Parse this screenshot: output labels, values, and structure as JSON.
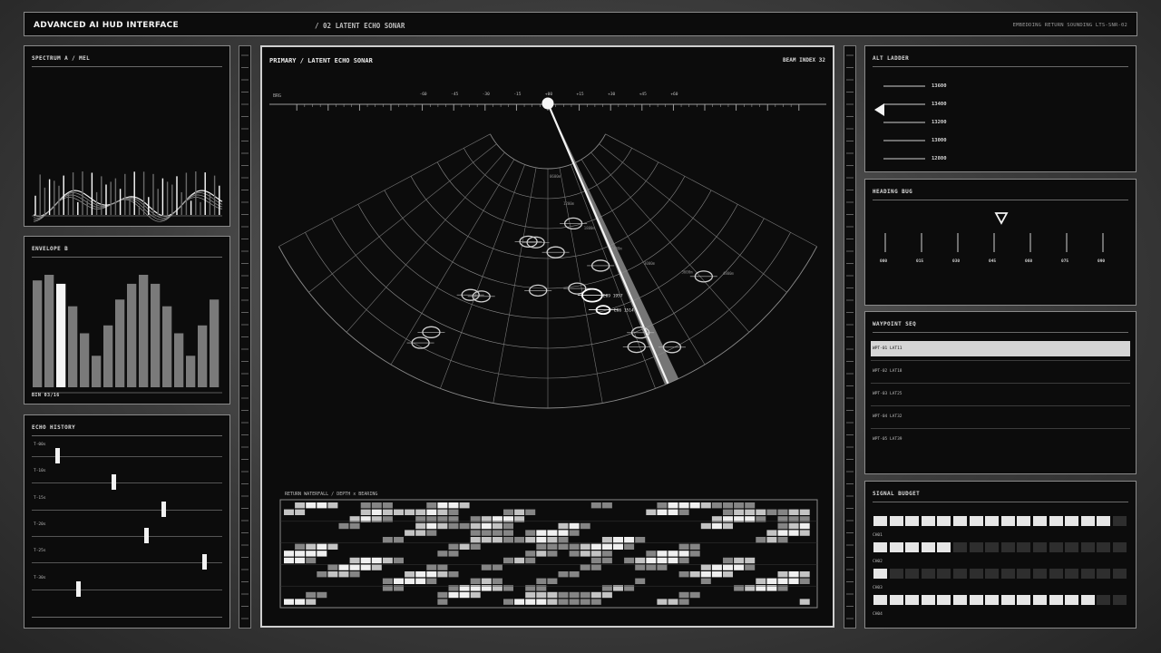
{
  "header": {
    "title": "ADVANCED AI HUD INTERFACE",
    "subtitle": "/ 02 LATENT ECHO SONAR",
    "right_tag": "EMBEDDING RETURN SOUNDING   LTS-SNR-02"
  },
  "left": {
    "spectrum_title": "SPECTRUM A / MEL",
    "envelope_title": "ENVELOPE B",
    "envelope_bars": [
      0.95,
      1.0,
      0.92,
      0.72,
      0.48,
      0.28,
      0.55,
      0.78,
      0.92,
      1.0,
      0.92,
      0.72,
      0.48,
      0.28,
      0.55,
      0.78
    ],
    "envelope_highlight_index": 2,
    "envelope_footer": "BIN 03/16",
    "echo_title": "ECHO HISTORY",
    "echo_rows": [
      {
        "label": "T-00s",
        "value": 0.12
      },
      {
        "label": "T-10s",
        "value": 0.44
      },
      {
        "label": "T-15s",
        "value": 0.72
      },
      {
        "label": "T-20s",
        "value": 0.62
      },
      {
        "label": "T-25s",
        "value": 0.95
      },
      {
        "label": "T-30s",
        "value": 0.24
      }
    ]
  },
  "main": {
    "title": "PRIMARY / LATENT ECHO SONAR",
    "beam_index": "BEAM INDEX 32",
    "brg_label": "BRG",
    "bearing_ticks": [
      "-60",
      "-45",
      "-30",
      "-15",
      "+00",
      "+15",
      "+30",
      "+45",
      "+60"
    ],
    "range_labels": [
      "0600m",
      "1200m",
      "1800m",
      "2400m",
      "3000m",
      "3600m",
      "4800m"
    ],
    "targets_bearing_range": [
      [
        -8,
        0.31
      ],
      [
        -5,
        0.31
      ],
      [
        3,
        0.35
      ],
      [
        12,
        0.24
      ],
      [
        -3,
        0.51
      ],
      [
        9,
        0.51
      ],
      [
        18,
        0.44
      ],
      [
        -22,
        0.59
      ],
      [
        -19,
        0.58
      ],
      [
        -27,
        0.8
      ],
      [
        -28,
        0.86
      ],
      [
        22,
        0.76
      ],
      [
        20,
        0.81
      ],
      [
        27,
        0.87
      ],
      [
        42,
        0.7
      ]
    ],
    "active_echoes": [
      {
        "bearing": 13,
        "range": 0.55,
        "label": "E09 1957"
      },
      {
        "bearing": 15,
        "range": 0.62,
        "label": "E06 1514"
      }
    ],
    "beam_bearing": 24,
    "waterfall_title": "RETURN WATERFALL / DEPTH x BEARING"
  },
  "right": {
    "alt_title": "ALT LADDER",
    "alt_values": [
      "13600",
      "13400",
      "13200",
      "13000",
      "12800"
    ],
    "heading_title": "HEADING BUG",
    "heading_ticks": [
      "000",
      "015",
      "030",
      "045",
      "060",
      "075",
      "090"
    ],
    "heading_bug_index": 3,
    "waypoint_title": "WAYPOINT SEQ",
    "waypoints": [
      "WPT-01  LAT11",
      "WPT-02  LAT18",
      "WPT-03  LAT25",
      "WPT-04  LAT32",
      "WPT-05  LAT39"
    ],
    "waypoint_active": 0,
    "budget_title": "SIGNAL BUDGET",
    "budget_rows": [
      {
        "label": "CH01",
        "filled": 15
      },
      {
        "label": "CH02",
        "filled": 5
      },
      {
        "label": "CH03",
        "filled": 1
      },
      {
        "label": "CH04",
        "filled": 14
      }
    ],
    "budget_total": 16
  },
  "colors": {
    "accent": "#e8e8e8",
    "panel": "#0c0c0c",
    "border": "#8a8a8a"
  }
}
